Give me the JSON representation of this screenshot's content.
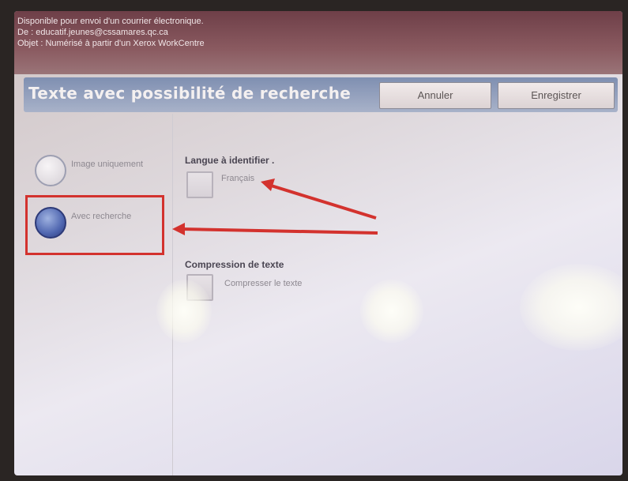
{
  "header": {
    "line1": "Disponible pour envoi d'un courrier électronique.",
    "line2": "De : educatif.jeunes@cssamares.qc.ca",
    "line3": "Objet : Numérisé à partir d'un Xerox WorkCentre"
  },
  "title_bar": {
    "title": "Texte avec possibilité de recherche",
    "cancel_label": "Annuler",
    "save_label": "Enregistrer"
  },
  "mode_options": [
    {
      "label": "Image uniquement",
      "selected": false
    },
    {
      "label": "Avec recherche",
      "selected": true
    }
  ],
  "language": {
    "heading": "Langue à identifier  .",
    "option_label": "Français",
    "checked": false
  },
  "compression": {
    "heading": "Compression de texte",
    "option_label": "Compresser le texte",
    "checked": false
  },
  "annotation_color": "#d3322e"
}
